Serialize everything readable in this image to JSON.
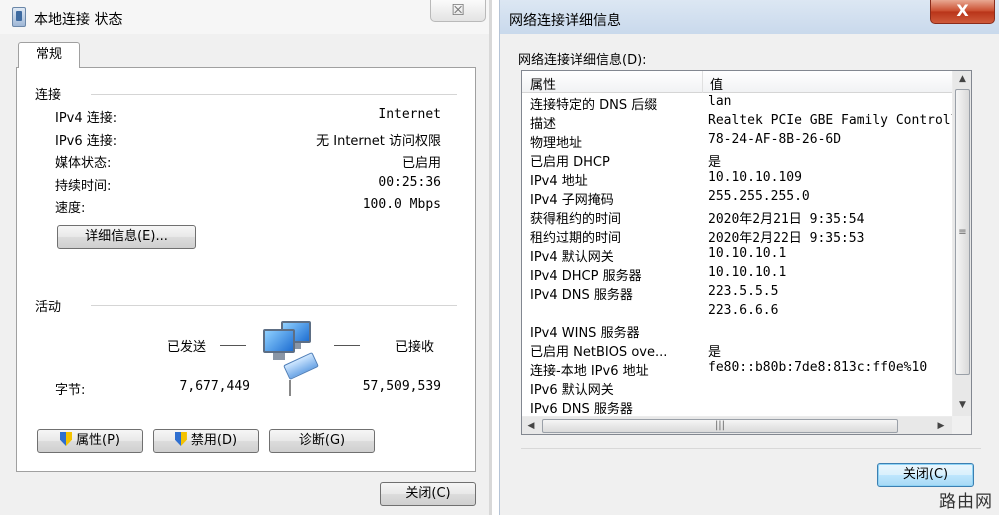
{
  "left_window": {
    "title": "本地连接 状态",
    "close_symbol": "☒",
    "tab": "常规",
    "connection": {
      "title": "连接",
      "rows": [
        {
          "label": "IPv4 连接:",
          "value": "Internet"
        },
        {
          "label": "IPv6 连接:",
          "value": "无 Internet 访问权限"
        },
        {
          "label": "媒体状态:",
          "value": "已启用"
        },
        {
          "label": "持续时间:",
          "value": "00:25:36"
        },
        {
          "label": "速度:",
          "value": "100.0 Mbps"
        }
      ],
      "details_button": "详细信息(E)..."
    },
    "activity": {
      "title": "活动",
      "sent_label": "已发送",
      "received_label": "已接收",
      "bytes_label": "字节:",
      "bytes_sent": "7,677,449",
      "bytes_received": "57,509,539"
    },
    "buttons": {
      "properties": "属性(P)",
      "disable": "禁用(D)",
      "diagnose": "诊断(G)",
      "close": "关闭(C)"
    }
  },
  "right_window": {
    "title": "网络连接详细信息",
    "close_symbol": "X",
    "caption": "网络连接详细信息(D):",
    "columns": {
      "property": "属性",
      "value": "值"
    },
    "rows": [
      {
        "property": "连接特定的 DNS 后缀",
        "value": "lan"
      },
      {
        "property": "描述",
        "value": "Realtek PCIe GBE Family Controller"
      },
      {
        "property": "物理地址",
        "value": "78-24-AF-8B-26-6D"
      },
      {
        "property": "已启用 DHCP",
        "value": "是"
      },
      {
        "property": "IPv4 地址",
        "value": "10.10.10.109"
      },
      {
        "property": "IPv4 子网掩码",
        "value": "255.255.255.0"
      },
      {
        "property": "获得租约的时间",
        "value": "2020年2月21日 9:35:54"
      },
      {
        "property": "租约过期的时间",
        "value": "2020年2月22日 9:35:53"
      },
      {
        "property": "IPv4 默认网关",
        "value": "10.10.10.1"
      },
      {
        "property": "IPv4 DHCP 服务器",
        "value": "10.10.10.1"
      },
      {
        "property": "IPv4 DNS 服务器",
        "value": "223.5.5.5"
      },
      {
        "property": "",
        "value": "223.6.6.6"
      },
      {
        "property": "IPv4 WINS 服务器",
        "value": ""
      },
      {
        "property": "已启用 NetBIOS ove...",
        "value": "是"
      },
      {
        "property": "连接-本地 IPv6 地址",
        "value": "fe80::b80b:7de8:813c:ff0e%10"
      },
      {
        "property": "IPv6 默认网关",
        "value": ""
      },
      {
        "property": "IPv6 DNS 服务器",
        "value": ""
      }
    ],
    "scroll": {
      "up": "▲",
      "down": "▼",
      "left": "◀",
      "right": "▶",
      "v_grip": "≡",
      "h_grip": "|||"
    },
    "close_button": "关闭(C)"
  },
  "watermark": "路由网"
}
